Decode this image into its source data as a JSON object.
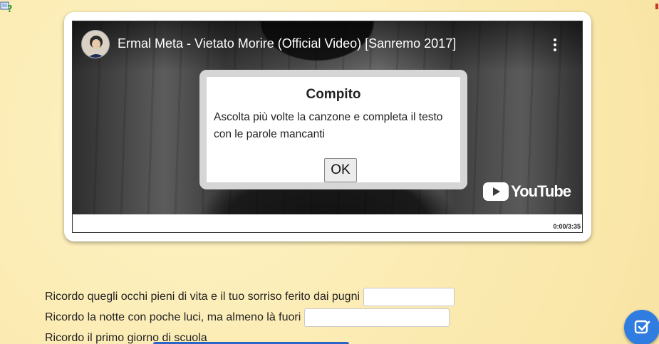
{
  "video": {
    "title": "Ermal Meta - Vietato Morire (Official Video) [Sanremo 2017]",
    "time": "0:00/3:35",
    "logo_text": "YouTube",
    "menu_icon": "kebab-menu-icon",
    "play_icon": "youtube-play-icon"
  },
  "modal": {
    "title": "Compito",
    "message": "Ascolta più volte la canzone e completa il testo con le parole mancanti",
    "ok_label": "OK"
  },
  "lyrics": {
    "line1": "Ricordo quegli occhi pieni di vita e il tuo sorriso ferito dai pugni",
    "line1_value": "",
    "line2": "Ricordo la notte con poche luci, ma almeno là fuori",
    "line2_value": "",
    "line3": "Ricordo il primo giorno di scuola"
  },
  "icons": {
    "help": "help-icon",
    "check": "check-icon"
  },
  "colors": {
    "background": "#fdefb6",
    "accent": "#2f7de1"
  }
}
